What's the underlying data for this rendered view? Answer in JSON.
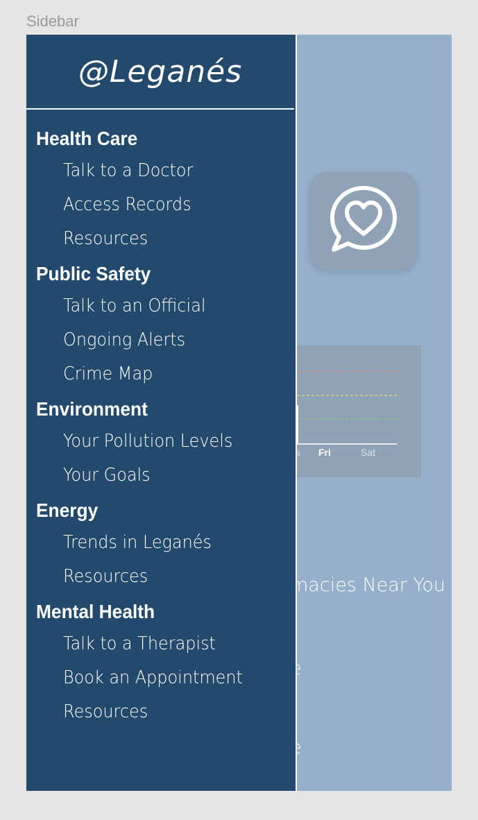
{
  "frame_label": "Sidebar",
  "brand": "@Leganés",
  "sidebar": {
    "sections": [
      {
        "title": "Health Care",
        "items": [
          "Talk to a Doctor",
          "Access Records",
          "Resources"
        ]
      },
      {
        "title": "Public Safety",
        "items": [
          "Talk to an Official",
          "Ongoing Alerts",
          "Crime Map"
        ]
      },
      {
        "title": "Environment",
        "items": [
          "Your Pollution Levels",
          "Your Goals"
        ]
      },
      {
        "title": "Energy",
        "items": [
          "Trends in Leganés",
          "Resources"
        ]
      },
      {
        "title": "Mental Health",
        "items": [
          "Talk to a Therapist",
          "Book an Appointment",
          "Resources"
        ]
      }
    ]
  },
  "background": {
    "chart_days": [
      "s",
      "Fri",
      "Sat"
    ],
    "pharmacies_text": "macies Near You",
    "partial_line_1": "e",
    "partial_line_2": "e"
  },
  "colors": {
    "sidebar_bg": "#234a6d",
    "app_bg": "#94b0cb",
    "card_bg": "#8fa2b6"
  },
  "icons": {
    "app_icon": "heart-chat-bubble-icon"
  }
}
